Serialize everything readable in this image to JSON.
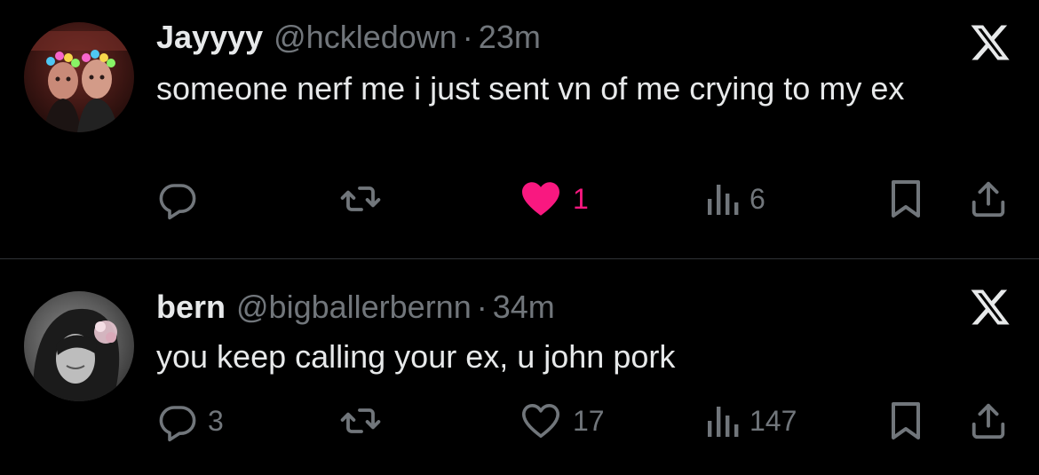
{
  "colors": {
    "background": "#000000",
    "text_primary": "#e7e9ea",
    "text_secondary": "#71767b",
    "like_active": "#f91880",
    "divider": "#2f3336"
  },
  "tweets": [
    {
      "display_name": "Jayyyy",
      "handle": "@hckledown",
      "separator": "·",
      "time": "23m",
      "text": "someone nerf me i just sent vn of me crying to my ex",
      "replies": "",
      "retweets": "",
      "likes": "1",
      "liked": true,
      "views": "6",
      "icons": [
        "reply-icon",
        "retweet-icon",
        "heart-filled-icon",
        "views-icon",
        "bookmark-icon",
        "share-icon",
        "x-logo-icon"
      ]
    },
    {
      "display_name": "bern",
      "handle": "@bigballerbernn",
      "separator": "·",
      "time": "34m",
      "text": "you keep calling your ex, u john pork",
      "replies": "3",
      "retweets": "",
      "likes": "17",
      "liked": false,
      "views": "147",
      "icons": [
        "reply-icon",
        "retweet-icon",
        "heart-outline-icon",
        "views-icon",
        "bookmark-icon",
        "share-icon",
        "x-logo-icon"
      ]
    }
  ]
}
